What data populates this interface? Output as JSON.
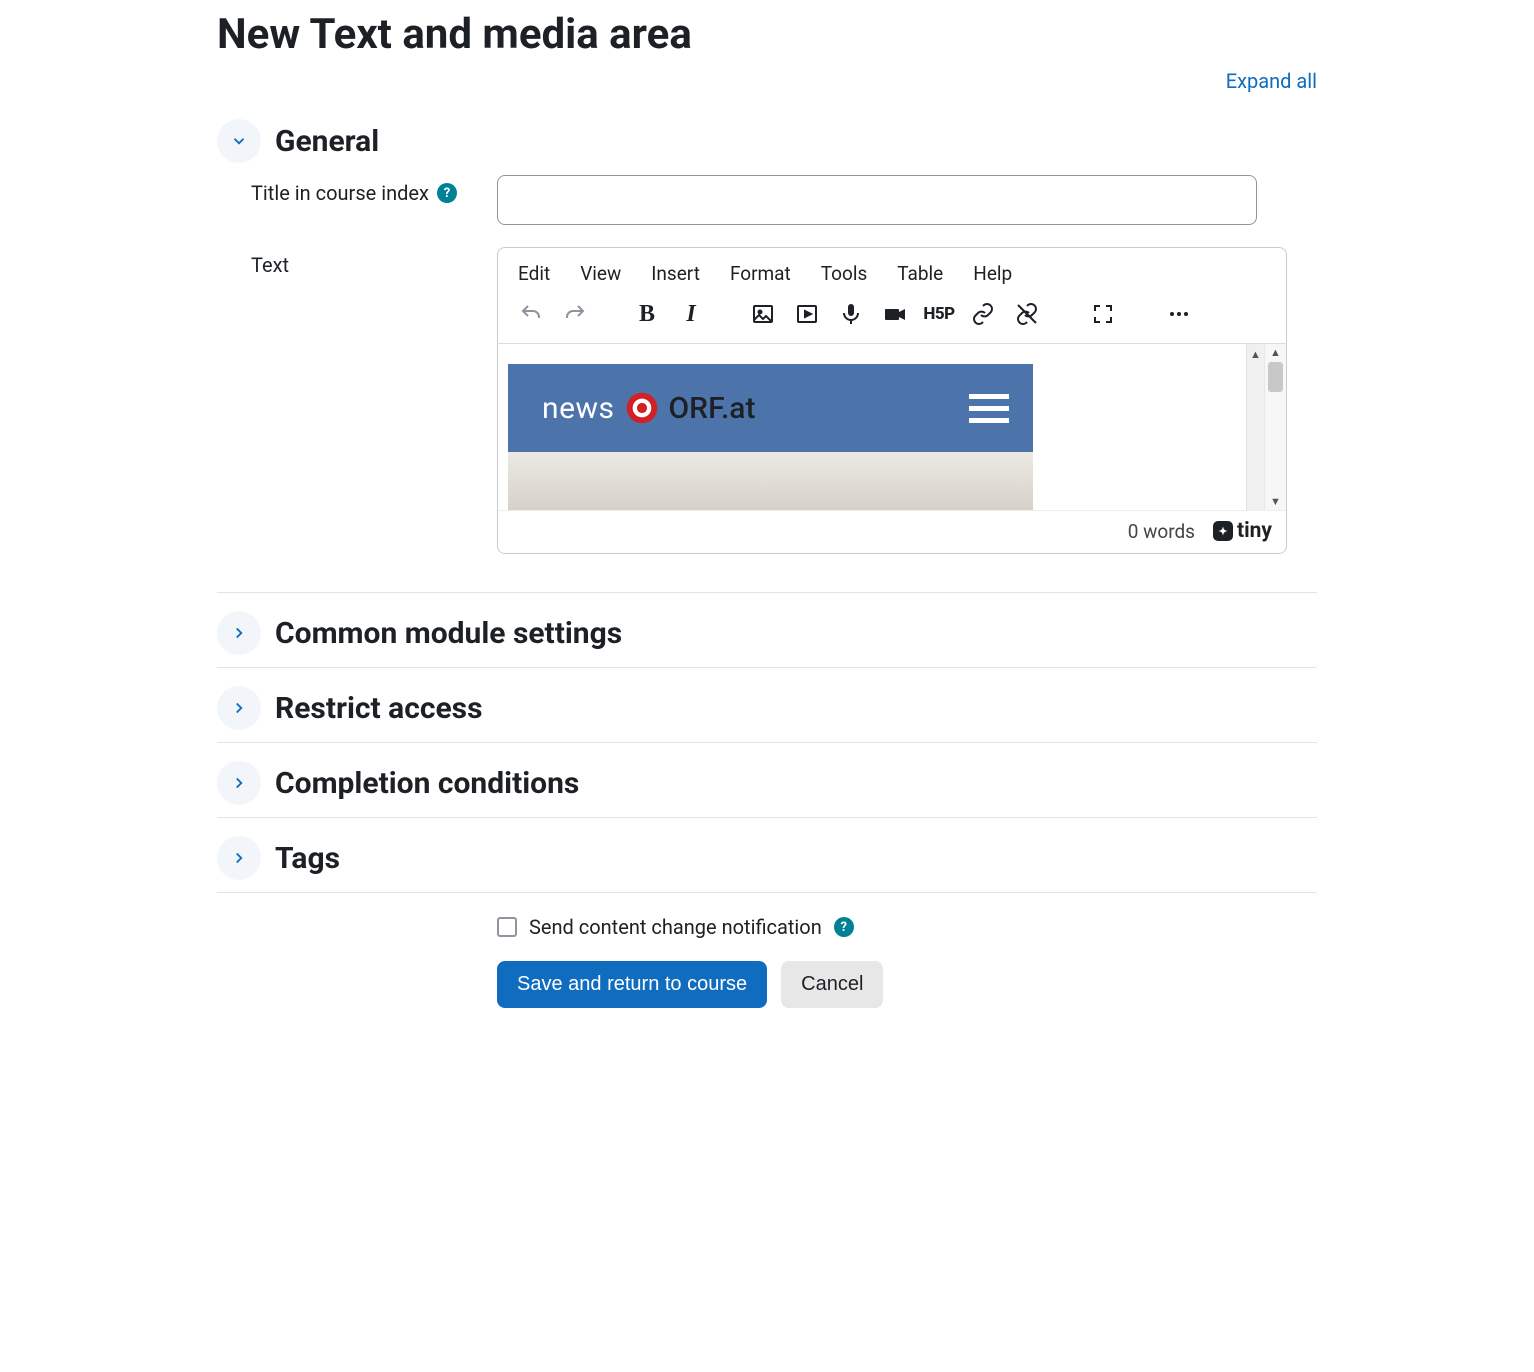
{
  "page_title": "New Text and media area",
  "expand_all": "Expand all",
  "sections": {
    "general": {
      "title": "General",
      "expanded": true
    },
    "common": {
      "title": "Common module settings"
    },
    "restrict": {
      "title": "Restrict access"
    },
    "completion": {
      "title": "Completion conditions"
    },
    "tags": {
      "title": "Tags"
    }
  },
  "general": {
    "title_label": "Title in course index",
    "title_value": "",
    "text_label": "Text"
  },
  "editor": {
    "menus": {
      "edit": "Edit",
      "view": "View",
      "insert": "Insert",
      "format": "Format",
      "tools": "Tools",
      "table": "Table",
      "help": "Help"
    },
    "h5p_label": "H5P",
    "word_count": "0 words",
    "brand": "tiny"
  },
  "embedded": {
    "news": "news",
    "site": "ORF.at"
  },
  "notify": {
    "label": "Send content change notification"
  },
  "actions": {
    "save": "Save and return to course",
    "cancel": "Cancel"
  }
}
